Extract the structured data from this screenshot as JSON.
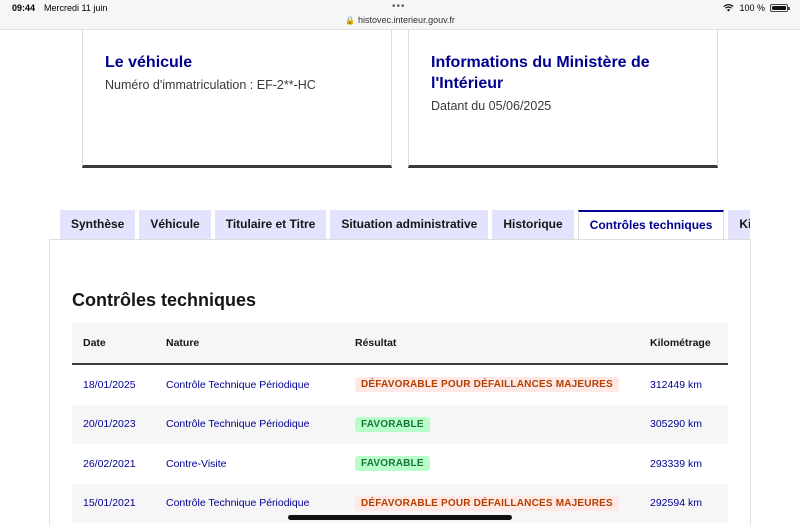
{
  "statusbar": {
    "time": "09:44",
    "date": "Mercredi 11 juin",
    "dots": "•••",
    "url": "histovec.interieur.gouv.fr",
    "battery": "100 %"
  },
  "cards": {
    "vehicle": {
      "title": "Le véhicule",
      "text": "Numéro d'immatriculation : EF-2**-HC"
    },
    "ministry": {
      "title": "Informations du Ministère de l'Intérieur",
      "text": "Datant du 05/06/2025"
    }
  },
  "tabs": [
    {
      "label": "Synthèse"
    },
    {
      "label": "Véhicule"
    },
    {
      "label": "Titulaire et Titre"
    },
    {
      "label": "Situation administrative"
    },
    {
      "label": "Historique"
    },
    {
      "label": "Contrôles techniques"
    },
    {
      "label": "Kilo"
    }
  ],
  "active_tab": "Contrôles techniques",
  "section_title": "Contrôles techniques",
  "table": {
    "headers": [
      "Date",
      "Nature",
      "Résultat",
      "Kilométrage"
    ],
    "rows": [
      {
        "date": "18/01/2025",
        "nature": "Contrôle Technique Périodique",
        "result": "DÉFAVORABLE POUR DÉFAILLANCES MAJEURES",
        "status": "bad",
        "km": "312449 km"
      },
      {
        "date": "20/01/2023",
        "nature": "Contrôle Technique Périodique",
        "result": "FAVORABLE",
        "status": "good",
        "km": "305290 km"
      },
      {
        "date": "26/02/2021",
        "nature": "Contre-Visite",
        "result": "FAVORABLE",
        "status": "good",
        "km": "293339 km"
      },
      {
        "date": "15/01/2021",
        "nature": "Contrôle Technique Périodique",
        "result": "DÉFAVORABLE POUR DÉFAILLANCES MAJEURES",
        "status": "bad",
        "km": "292594 km"
      }
    ]
  },
  "colors": {
    "primary_blue": "#000091",
    "tab_bg": "#e3e3fd",
    "bad_badge_bg": "#ffe9e6",
    "bad_badge_text": "#b34000",
    "good_badge_bg": "#b8fec9",
    "good_badge_text": "#18753c"
  }
}
